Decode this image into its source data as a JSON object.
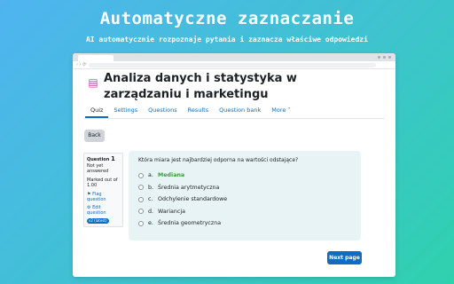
{
  "promo": {
    "title": "Automatyczne zaznaczanie",
    "subtitle": "AI automatycznie rozpoznaje pytania i zaznacza właściwe odpowiedzi"
  },
  "course": {
    "title": "Analiza danych i statystyka w zarządzaniu i marketingu",
    "icon": "quiz-icon",
    "icon_color": "#c24ba0"
  },
  "tabs": [
    "Quiz",
    "Settings",
    "Questions",
    "Results",
    "Question bank",
    "More ˅"
  ],
  "back_label": "Back",
  "question_info": {
    "label": "Question",
    "number": "1",
    "status": "Not yet answered",
    "marks": "Marked out of 1.00",
    "flag": "Flag question",
    "edit": "Edit question",
    "badge": "v2 (latest)"
  },
  "question": {
    "text": "Która miara jest najbardziej odporna na wartości odstające?",
    "options": [
      {
        "letter": "a.",
        "text": "Mediana",
        "correct": true
      },
      {
        "letter": "b.",
        "text": "Średnia arytmetyczna",
        "correct": false
      },
      {
        "letter": "c.",
        "text": "Odchylenie standardowe",
        "correct": false
      },
      {
        "letter": "d.",
        "text": "Wariancja",
        "correct": false
      },
      {
        "letter": "e.",
        "text": "Średnia geometryczna",
        "correct": false
      }
    ]
  },
  "next_label": "Next page",
  "colors": {
    "accent": "#0f6cbf",
    "correct": "#3b9e3b"
  }
}
